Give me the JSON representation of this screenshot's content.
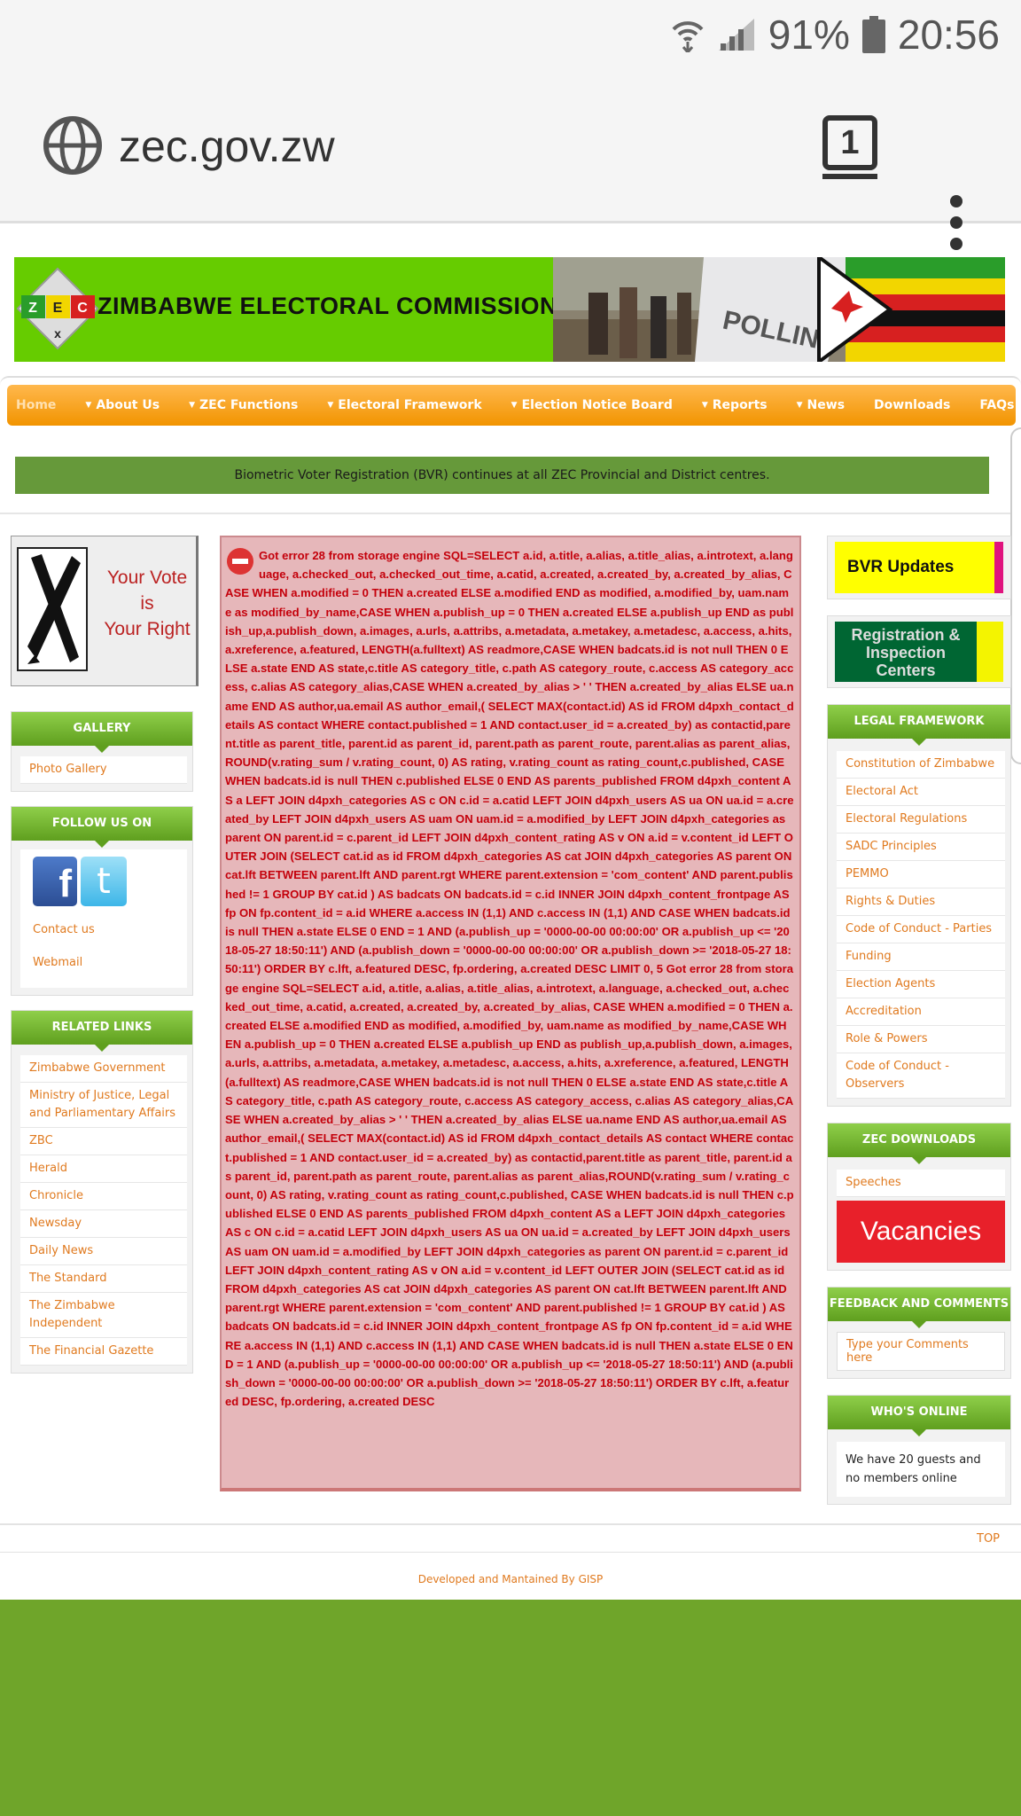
{
  "status_bar": {
    "battery": "91%",
    "time": "20:56"
  },
  "browser": {
    "url": "zec.gov.zw",
    "tab_count": "1"
  },
  "banner": {
    "title": "ZIMBABWE ELECTORAL COMMISSION",
    "logo_letters": [
      "Z",
      "E",
      "C"
    ],
    "photo_caption": "POLLING STA"
  },
  "nav": {
    "items": [
      {
        "label": "Home",
        "dropdown": false
      },
      {
        "label": "About Us",
        "dropdown": true
      },
      {
        "label": "ZEC Functions",
        "dropdown": true
      },
      {
        "label": "Electoral Framework",
        "dropdown": true
      },
      {
        "label": "Election Notice Board",
        "dropdown": true
      },
      {
        "label": "Reports",
        "dropdown": true
      },
      {
        "label": "News",
        "dropdown": true
      },
      {
        "label": "Downloads",
        "dropdown": false
      },
      {
        "label": "FAQs",
        "dropdown": false
      }
    ]
  },
  "announcement": "Biometric Voter Registration (BVR) continues at all ZEC Provincial and District centres.",
  "left": {
    "vote_image": {
      "line1": "Your Vote",
      "line2": "is",
      "line3": "Your Right"
    },
    "gallery": {
      "title": "GALLERY",
      "links": [
        "Photo Gallery"
      ]
    },
    "follow": {
      "title": "FOLLOW US ON",
      "links": [
        "Contact us",
        "Webmail"
      ]
    },
    "related": {
      "title": "RELATED LINKS",
      "links": [
        "Zimbabwe Government",
        "Ministry of Justice, Legal and Parliamentary Affairs",
        "ZBC",
        "Herald",
        "Chronicle",
        "Newsday",
        "Daily News",
        "The Standard",
        "The Zimbabwe Independent",
        "The Financial Gazette"
      ]
    }
  },
  "error_text": "Got error 28 from storage engine SQL=SELECT a.id, a.title, a.alias, a.title_alias, a.introtext, a.language, a.checked_out, a.checked_out_time, a.catid, a.created, a.created_by, a.created_by_alias, CASE WHEN a.modified = 0 THEN a.created ELSE a.modified END as modified, a.modified_by, uam.name as modified_by_name,CASE WHEN a.publish_up = 0 THEN a.created ELSE a.publish_up END as publish_up,a.publish_down, a.images, a.urls, a.attribs, a.metadata, a.metakey, a.metadesc, a.access, a.hits, a.xreference, a.featured, LENGTH(a.fulltext) AS readmore,CASE WHEN badcats.id is not null THEN 0 ELSE a.state END AS state,c.title AS category_title, c.path AS category_route, c.access AS category_access, c.alias AS category_alias,CASE WHEN a.created_by_alias > ' ' THEN a.created_by_alias ELSE ua.name END AS author,ua.email AS author_email,( SELECT MAX(contact.id) AS id FROM d4pxh_contact_details AS contact WHERE contact.published = 1 AND contact.user_id = a.created_by) as contactid,parent.title as parent_title, parent.id as parent_id, parent.path as parent_route, parent.alias as parent_alias,ROUND(v.rating_sum / v.rating_count, 0) AS rating, v.rating_count as rating_count,c.published, CASE WHEN badcats.id is null THEN c.published ELSE 0 END AS parents_published FROM d4pxh_content AS a LEFT JOIN d4pxh_categories AS c ON c.id = a.catid LEFT JOIN d4pxh_users AS ua ON ua.id = a.created_by LEFT JOIN d4pxh_users AS uam ON uam.id = a.modified_by LEFT JOIN d4pxh_categories as parent ON parent.id = c.parent_id LEFT JOIN d4pxh_content_rating AS v ON a.id = v.content_id LEFT OUTER JOIN (SELECT cat.id as id FROM d4pxh_categories AS cat JOIN d4pxh_categories AS parent ON cat.lft BETWEEN parent.lft AND parent.rgt WHERE parent.extension = 'com_content' AND parent.published != 1 GROUP BY cat.id ) AS badcats ON badcats.id = c.id INNER JOIN d4pxh_content_frontpage AS fp ON fp.content_id = a.id WHERE a.access IN (1,1) AND c.access IN (1,1) AND CASE WHEN badcats.id is null THEN a.state ELSE 0 END = 1 AND (a.publish_up = '0000-00-00 00:00:00' OR a.publish_up <= '2018-05-27 18:50:11') AND (a.publish_down = '0000-00-00 00:00:00' OR a.publish_down >= '2018-05-27 18:50:11') ORDER BY c.lft, a.featured DESC, fp.ordering, a.created DESC LIMIT 0, 5 Got error 28 from storage engine SQL=SELECT a.id, a.title, a.alias, a.title_alias, a.introtext, a.language, a.checked_out, a.checked_out_time, a.catid, a.created, a.created_by, a.created_by_alias, CASE WHEN a.modified = 0 THEN a.created ELSE a.modified END as modified, a.modified_by, uam.name as modified_by_name,CASE WHEN a.publish_up = 0 THEN a.created ELSE a.publish_up END as publish_up,a.publish_down, a.images, a.urls, a.attribs, a.metadata, a.metakey, a.metadesc, a.access, a.hits, a.xreference, a.featured, LENGTH(a.fulltext) AS readmore,CASE WHEN badcats.id is not null THEN 0 ELSE a.state END AS state,c.title AS category_title, c.path AS category_route, c.access AS category_access, c.alias AS category_alias,CASE WHEN a.created_by_alias > ' ' THEN a.created_by_alias ELSE ua.name END AS author,ua.email AS author_email,( SELECT MAX(contact.id) AS id FROM d4pxh_contact_details AS contact WHERE contact.published = 1 AND contact.user_id = a.created_by) as contactid,parent.title as parent_title, parent.id as parent_id, parent.path as parent_route, parent.alias as parent_alias,ROUND(v.rating_sum / v.rating_count, 0) AS rating, v.rating_count as rating_count,c.published, CASE WHEN badcats.id is null THEN c.published ELSE 0 END AS parents_published FROM d4pxh_content AS a LEFT JOIN d4pxh_categories AS c ON c.id = a.catid LEFT JOIN d4pxh_users AS ua ON ua.id = a.created_by LEFT JOIN d4pxh_users AS uam ON uam.id = a.modified_by LEFT JOIN d4pxh_categories as parent ON parent.id = c.parent_id LEFT JOIN d4pxh_content_rating AS v ON a.id = v.content_id LEFT OUTER JOIN (SELECT cat.id as id FROM d4pxh_categories AS cat JOIN d4pxh_categories AS parent ON cat.lft BETWEEN parent.lft AND parent.rgt WHERE parent.extension = 'com_content' AND parent.published != 1 GROUP BY cat.id ) AS badcats ON badcats.id = c.id INNER JOIN d4pxh_content_frontpage AS fp ON fp.content_id = a.id WHERE a.access IN (1,1) AND c.access IN (1,1) AND CASE WHEN badcats.id is null THEN a.state ELSE 0 END = 1 AND (a.publish_up = '0000-00-00 00:00:00' OR a.publish_up <= '2018-05-27 18:50:11') AND (a.publish_down = '0000-00-00 00:00:00' OR a.publish_down >= '2018-05-27 18:50:11') ORDER BY c.lft, a.featured DESC, fp.ordering, a.created DESC",
  "right": {
    "bvr_button": "BVR Updates",
    "registration_button_line1": "Registration &",
    "registration_button_line2": "Inspection",
    "registration_button_line3": "Centers",
    "legal": {
      "title": "LEGAL FRAMEWORK",
      "links": [
        "Constitution of Zimbabwe",
        "Electoral Act",
        "Electoral Regulations",
        "SADC Principles",
        "PEMMO",
        "Rights & Duties",
        "Code of Conduct - Parties",
        "Funding",
        "Election Agents",
        "Accreditation",
        "Role & Powers",
        "Code of Conduct - Observers"
      ]
    },
    "downloads": {
      "title": "ZEC DOWNLOADS",
      "links": [
        "Speeches"
      ],
      "vacancies": "Vacancies"
    },
    "feedback": {
      "title": "FEEDBACK AND COMMENTS",
      "placeholder": "Type your Comments here"
    },
    "online": {
      "title": "WHO'S ONLINE",
      "text": "We have 20 guests and no members online"
    }
  },
  "footer": {
    "top_link": "TOP",
    "credit": "Developed and Mantained By GISP"
  }
}
